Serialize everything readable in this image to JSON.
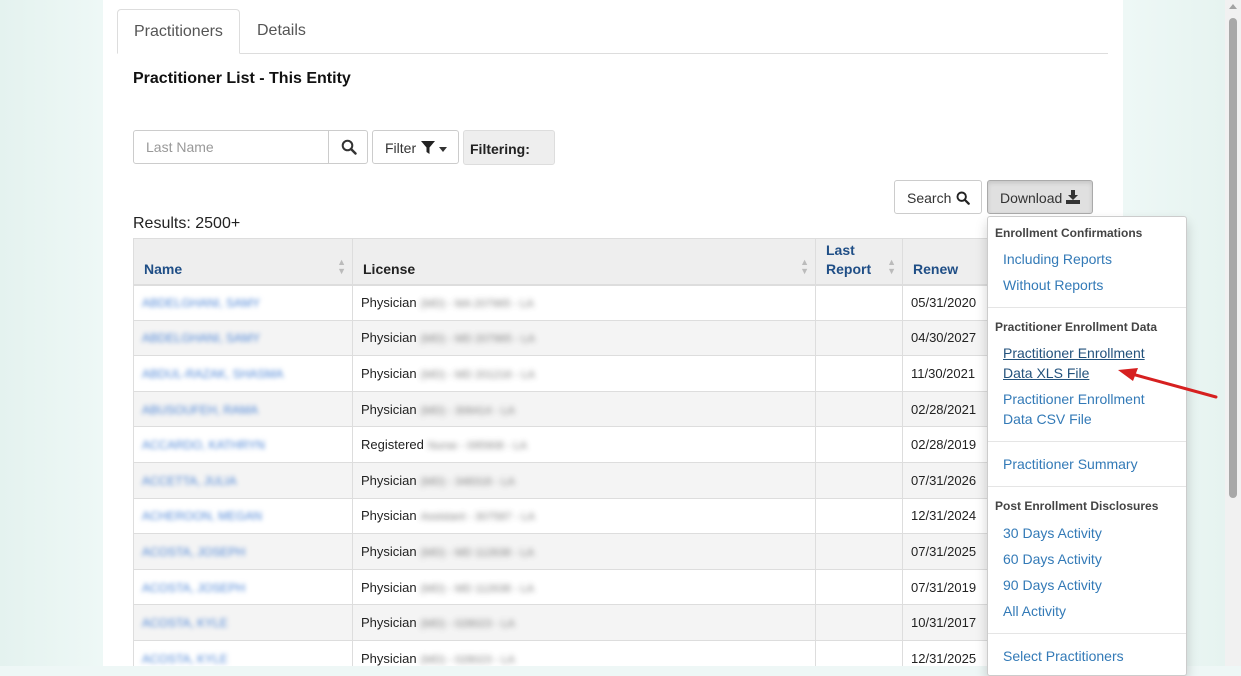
{
  "tabs": [
    "Practitioners",
    "Details"
  ],
  "page_title": "Practitioner List - This Entity",
  "search": {
    "placeholder": "Last Name"
  },
  "filter": {
    "label": "Filter",
    "filtering_label": "Filtering:"
  },
  "buttons": {
    "search": "Search",
    "download": "Download"
  },
  "results_text": "Results: 2500+",
  "table": {
    "columns": [
      "Name",
      "License",
      "Last Report",
      "Renew"
    ],
    "rows": [
      {
        "name": "ABDELGHANI, SAMY",
        "license_type": "Physician",
        "license_detail": "(MD) - MA 207965 - LA",
        "last_report": "",
        "renew": "05/31/2020"
      },
      {
        "name": "ABDELGHANI, SAMY",
        "license_type": "Physician",
        "license_detail": "(MD) - MD 207965 - LA",
        "last_report": "",
        "renew": "04/30/2027"
      },
      {
        "name": "ABDUL-RAZAK, SHASMA",
        "license_type": "Physician",
        "license_detail": "(MD) - MD 201216 - LA",
        "last_report": "",
        "renew": "11/30/2021"
      },
      {
        "name": "ABUSOUFEH, RAMA",
        "license_type": "Physician",
        "license_detail": "(MD) - 306414 - LA",
        "last_report": "",
        "renew": "02/28/2021"
      },
      {
        "name": "ACCARDO, KATHRYN",
        "license_type": "Registered",
        "license_detail": "Nurse - 095908 - LA",
        "last_report": "",
        "renew": "02/28/2019"
      },
      {
        "name": "ACCETTA, JULIA",
        "license_type": "Physician",
        "license_detail": "(MD) - 348318 - LA",
        "last_report": "",
        "renew": "07/31/2026"
      },
      {
        "name": "ACHEROON, MEGAN",
        "license_type": "Physician",
        "license_detail": "Assistant - 307587 - LA",
        "last_report": "",
        "renew": "12/31/2024"
      },
      {
        "name": "ACOSTA, JOSEPH",
        "license_type": "Physician",
        "license_detail": "(MD) - MD 112638 - LA",
        "last_report": "",
        "renew": "07/31/2025"
      },
      {
        "name": "ACOSTA, JOSEPH",
        "license_type": "Physician",
        "license_detail": "(MD) - MD 112638 - LA",
        "last_report": "",
        "renew": "07/31/2019"
      },
      {
        "name": "ACOSTA, KYLE",
        "license_type": "Physician",
        "license_detail": "(MD) - 028023 - LA",
        "last_report": "",
        "renew": "10/31/2017"
      },
      {
        "name": "ACOSTA, KYLE",
        "license_type": "Physician",
        "license_detail": "(MD) - 028023 - LA",
        "last_report": "",
        "renew": "12/31/2025"
      }
    ]
  },
  "download_menu": {
    "sections": [
      {
        "header": "Enrollment Confirmations",
        "items": [
          "Including Reports",
          "Without Reports"
        ]
      },
      {
        "header": "Practitioner Enrollment Data",
        "items": [
          "Practitioner Enrollment Data XLS File",
          "Practitioner Enrollment Data CSV File"
        ]
      },
      {
        "header": "",
        "items": [
          "Practitioner Summary"
        ]
      },
      {
        "header": "Post Enrollment Disclosures",
        "items": [
          "30 Days Activity",
          "60 Days Activity",
          "90 Days Activity",
          "All Activity"
        ]
      },
      {
        "header": "",
        "items": [
          "Select Practitioners"
        ]
      }
    ],
    "xls_line1": "Practitioner Enrollment",
    "xls_line2": "Data XLS File",
    "csv_line1": "Practitioner Enrollment",
    "csv_line2": "Data CSV File"
  },
  "colors": {
    "link": "#337ab7",
    "annotation_arrow": "#d62020",
    "header_link": "#1f4e86"
  },
  "icons": [
    "search-icon",
    "filter-funnel-icon",
    "caret-down-icon",
    "download-icon",
    "sort-icon",
    "annotation-arrow-icon"
  ]
}
